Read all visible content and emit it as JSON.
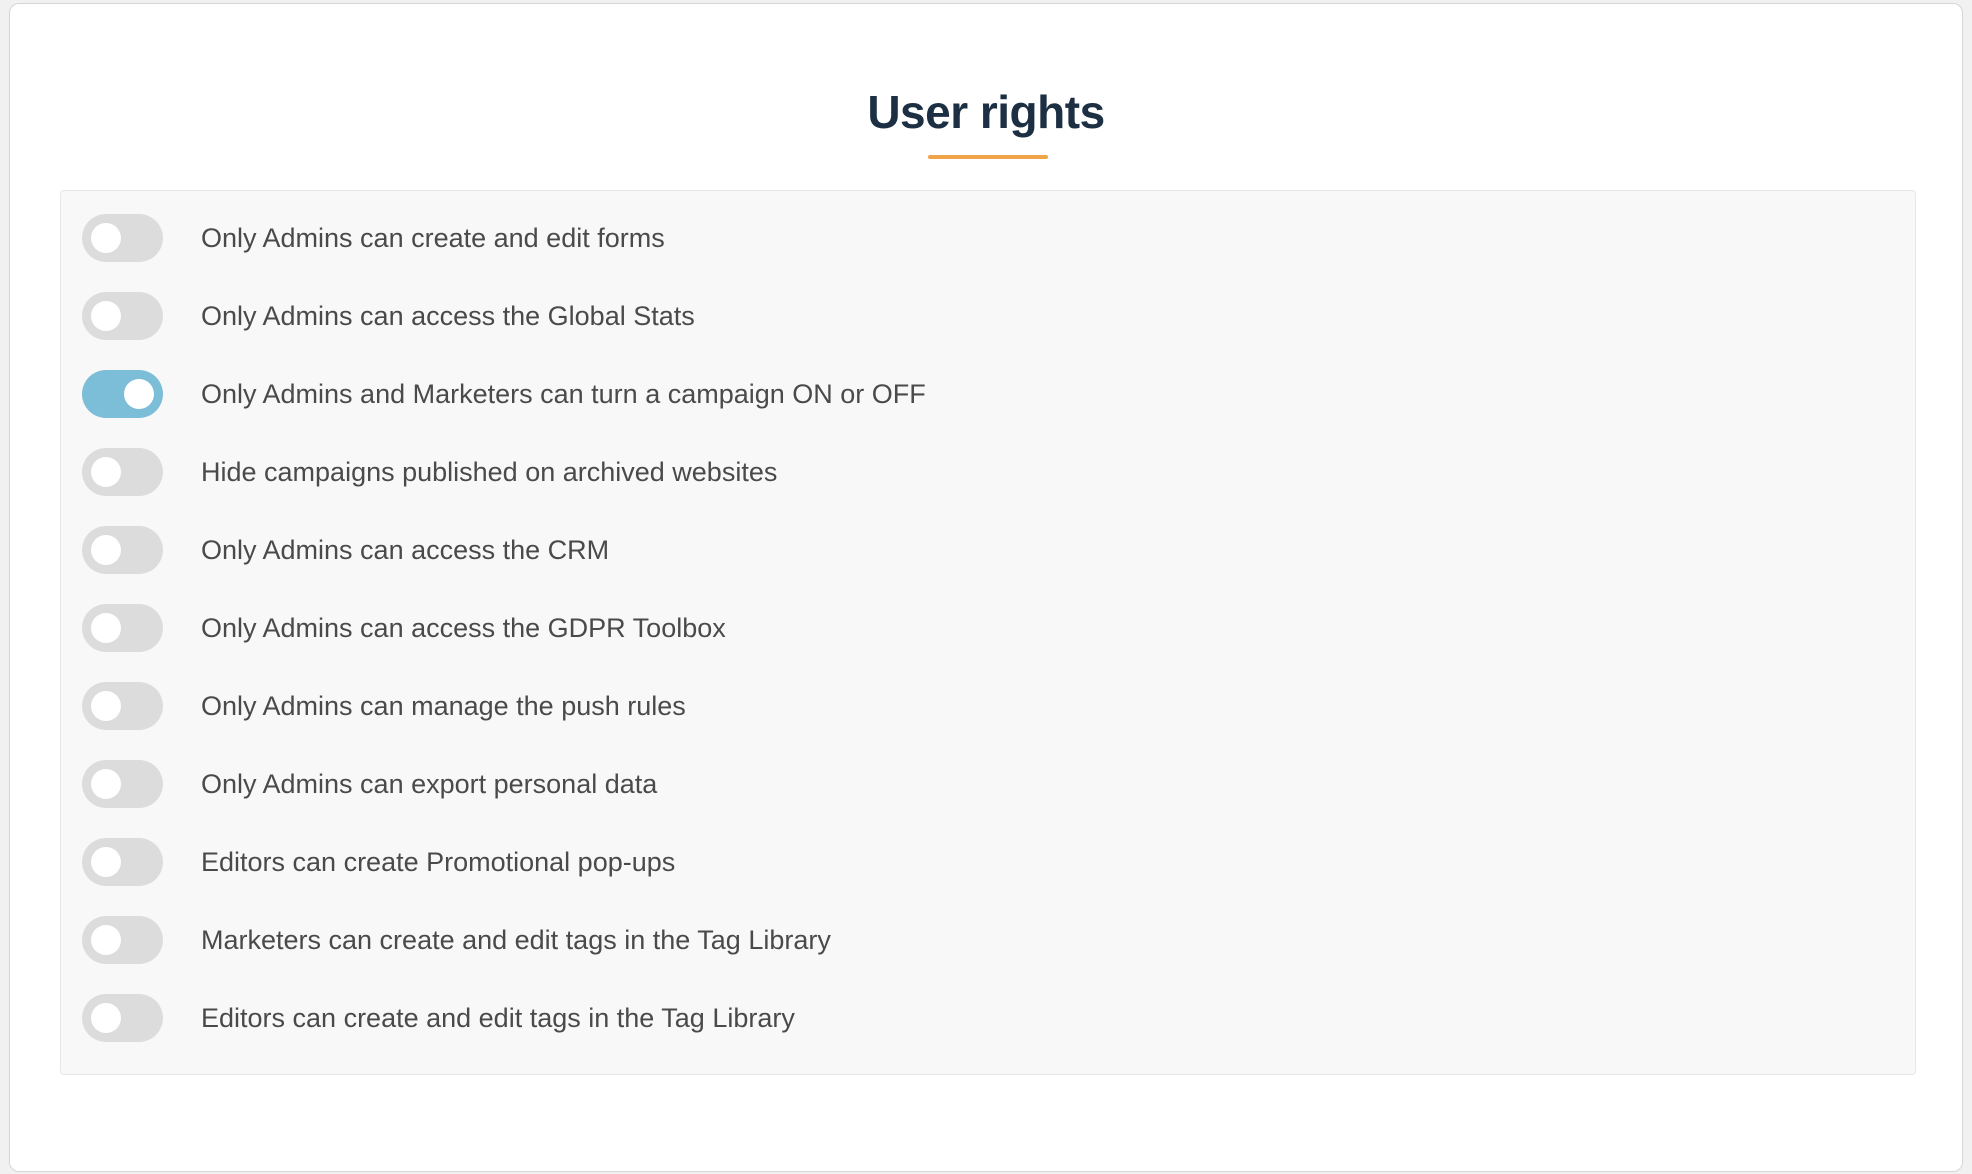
{
  "page": {
    "title": "User rights"
  },
  "colors": {
    "accent_underline": "#f0a44a",
    "toggle_on": "#7cbdd7",
    "toggle_off": "#dcdcdc",
    "title": "#1d2f42"
  },
  "settings": [
    {
      "label": "Only Admins can create and edit forms",
      "enabled": false
    },
    {
      "label": "Only Admins can access the Global Stats",
      "enabled": false
    },
    {
      "label": "Only Admins and Marketers can turn a campaign ON or OFF",
      "enabled": true
    },
    {
      "label": "Hide campaigns published on archived websites",
      "enabled": false
    },
    {
      "label": "Only Admins can access the CRM",
      "enabled": false
    },
    {
      "label": "Only Admins can access the GDPR Toolbox",
      "enabled": false
    },
    {
      "label": "Only Admins can manage the push rules",
      "enabled": false
    },
    {
      "label": "Only Admins can export personal data",
      "enabled": false
    },
    {
      "label": "Editors can create Promotional pop-ups",
      "enabled": false
    },
    {
      "label": "Marketers can create and edit tags in the Tag Library",
      "enabled": false
    },
    {
      "label": "Editors can create and edit tags in the Tag Library",
      "enabled": false
    }
  ]
}
